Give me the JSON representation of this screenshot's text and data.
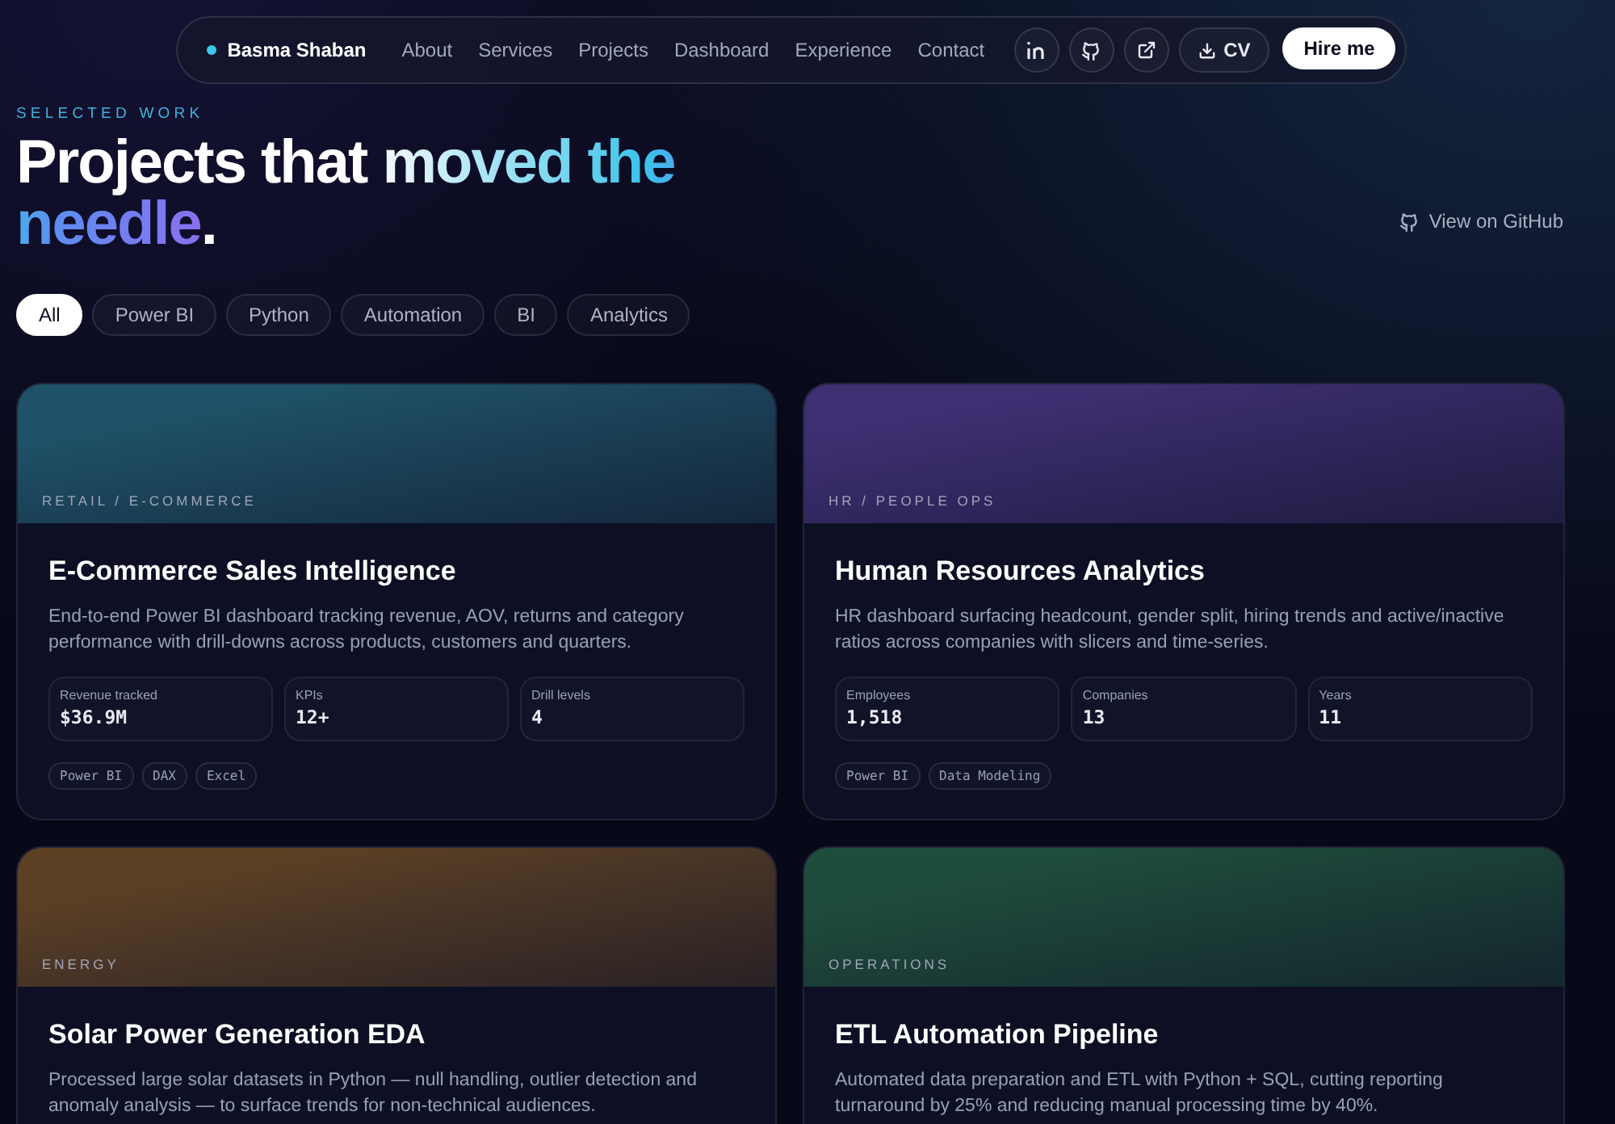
{
  "nav": {
    "brand": "Basma Shaban",
    "links": [
      "About",
      "Services",
      "Projects",
      "Dashboard",
      "Experience",
      "Contact"
    ],
    "icon_buttons": [
      {
        "kind": "linkedin"
      },
      {
        "kind": "github"
      },
      {
        "kind": "external"
      }
    ],
    "cv_button": "CV",
    "cta": "Hire me"
  },
  "header": {
    "eyebrow": "SELECTED WORK",
    "title_lead": "Projects that ",
    "title_accent": "moved the needle",
    "title_end": ".",
    "github_link": "View on GitHub"
  },
  "filters": [
    {
      "label": "All",
      "selected": true
    },
    {
      "label": "Power BI",
      "selected": false
    },
    {
      "label": "Python",
      "selected": false
    },
    {
      "label": "Automation",
      "selected": false
    },
    {
      "label": "BI",
      "selected": false
    },
    {
      "label": "Analytics",
      "selected": false
    }
  ],
  "projects": [
    {
      "category": "RETAIL / E-COMMERCE",
      "color": "#1f5268",
      "title": "E-Commerce Sales Intelligence",
      "description": "End-to-end Power BI dashboard tracking revenue, AOV, returns and category performance with drill-downs across products, customers and quarters.",
      "stats": [
        {
          "label": "Revenue tracked",
          "value": "$36.9M"
        },
        {
          "label": "KPIs",
          "value": "12+"
        },
        {
          "label": "Drill levels",
          "value": "4"
        }
      ],
      "tags": [
        "Power BI",
        "DAX",
        "Excel"
      ]
    },
    {
      "category": "HR / PEOPLE OPS",
      "color": "#3e2f72",
      "title": "Human Resources Analytics",
      "description": "HR dashboard surfacing headcount, gender split, hiring trends and active/inactive ratios across companies with slicers and time-series.",
      "stats": [
        {
          "label": "Employees",
          "value": "1,518"
        },
        {
          "label": "Companies",
          "value": "13"
        },
        {
          "label": "Years",
          "value": "11"
        }
      ],
      "tags": [
        "Power BI",
        "Data Modeling"
      ]
    },
    {
      "category": "ENERGY",
      "color": "#5c4024",
      "title": "Solar Power Generation EDA",
      "description": "Processed large solar datasets in Python — null handling, outlier detection and anomaly analysis — to surface trends for non-technical audiences."
    },
    {
      "category": "OPERATIONS",
      "color": "#1f4d3c",
      "title": "ETL Automation Pipeline",
      "description": "Automated data preparation and ETL with Python + SQL, cutting reporting turnaround by 25% and reducing manual processing time by 40%."
    }
  ]
}
